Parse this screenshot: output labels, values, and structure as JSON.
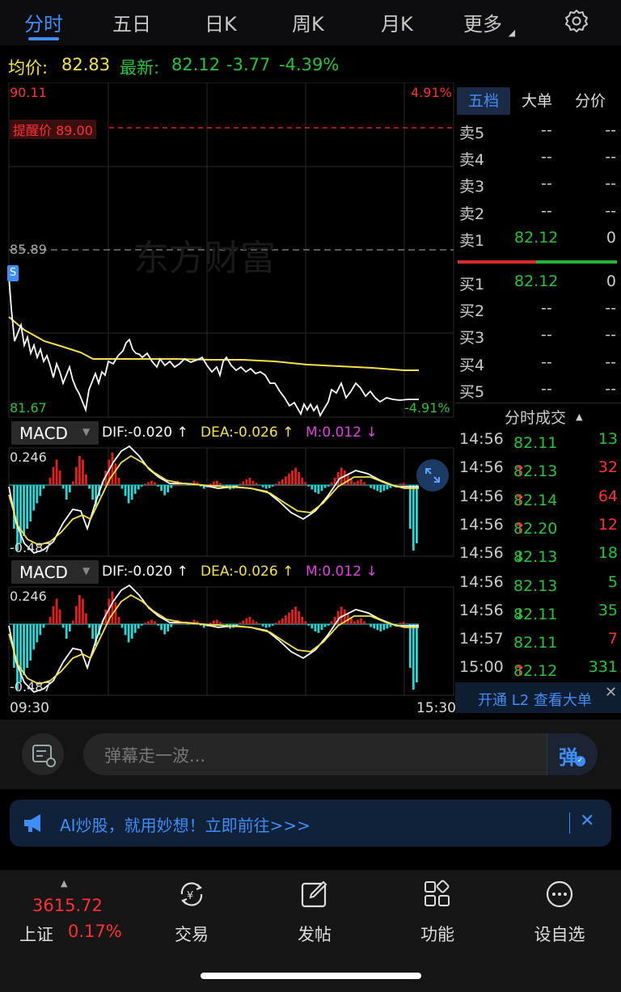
{
  "tabs": [
    {
      "label": "分时",
      "active": true
    },
    {
      "label": "五日"
    },
    {
      "label": "日K"
    },
    {
      "label": "周K"
    },
    {
      "label": "月K"
    },
    {
      "label": "更多"
    }
  ],
  "info": {
    "avg_label": "均价:",
    "avg_value": "82.83",
    "last_label": "最新:",
    "last_value": "82.12",
    "change": "-3.77",
    "change_pct": "-4.39%"
  },
  "price_chart": {
    "y_max": "90.11",
    "y_max_pct": "4.91%",
    "y_mid": "85.89",
    "y_min": "81.67",
    "y_min_pct": "-4.91%",
    "alert_label": "提醒价 89.00",
    "watermark": "东方财富",
    "marker": "S"
  },
  "macd_panels": [
    {
      "name": "MACD",
      "dif": "DIF:-0.020 ↑",
      "dea": "DEA:-0.026 ↑",
      "m": "M:0.012 ↓",
      "y_top": "0.246",
      "y_bottom": "-0.487"
    },
    {
      "name": "MACD",
      "dif": "DIF:-0.020 ↑",
      "dea": "DEA:-0.026 ↑",
      "m": "M:0.012 ↓",
      "y_top": "0.246",
      "y_bottom": "-0.487"
    }
  ],
  "time_axis": {
    "start": "09:30",
    "end": "15:30"
  },
  "right_panel": {
    "tabs": [
      "五档",
      "大单",
      "分价"
    ],
    "asks": [
      {
        "label": "卖5",
        "price": "--",
        "vol": "--"
      },
      {
        "label": "卖4",
        "price": "--",
        "vol": "--"
      },
      {
        "label": "卖3",
        "price": "--",
        "vol": "--"
      },
      {
        "label": "卖2",
        "price": "--",
        "vol": "--"
      },
      {
        "label": "卖1",
        "price": "82.12",
        "vol": "0"
      }
    ],
    "bids": [
      {
        "label": "买1",
        "price": "82.12",
        "vol": "0"
      },
      {
        "label": "买2",
        "price": "--",
        "vol": "--"
      },
      {
        "label": "买3",
        "price": "--",
        "vol": "--"
      },
      {
        "label": "买4",
        "price": "--",
        "vol": "--"
      },
      {
        "label": "买5",
        "price": "--",
        "vol": "--"
      }
    ],
    "trades_header": "分时成交",
    "trades": [
      {
        "time": "14:56",
        "price": "82.11",
        "arrow": "",
        "vol": "13",
        "vol_color": "#27c43a"
      },
      {
        "time": "14:56",
        "price": "82.13",
        "arrow": "↑",
        "vol": "32",
        "vol_color": "#ff3030"
      },
      {
        "time": "14:56",
        "price": "82.14",
        "arrow": "↑",
        "vol": "64",
        "vol_color": "#ff3030"
      },
      {
        "time": "14:56",
        "price": "82.20",
        "arrow": "↑",
        "vol": "12",
        "vol_color": "#ff3030"
      },
      {
        "time": "14:56",
        "price": "82.13",
        "arrow": "↓",
        "vol": "18",
        "vol_color": "#27c43a"
      },
      {
        "time": "14:56",
        "price": "82.13",
        "arrow": "",
        "vol": "5",
        "vol_color": "#27c43a"
      },
      {
        "time": "14:56",
        "price": "82.11",
        "arrow": "↓",
        "vol": "35",
        "vol_color": "#27c43a"
      },
      {
        "time": "14:57",
        "price": "82.11",
        "arrow": "",
        "vol": "7",
        "vol_color": "#ff3030"
      },
      {
        "time": "15:00",
        "price": "82.12",
        "arrow": "↑",
        "vol": "331",
        "vol_color": "#27c43a"
      }
    ],
    "l2_banner": "开通 L2 查看大单"
  },
  "danmu": {
    "placeholder": "弹幕走一波...",
    "button": "弹"
  },
  "ai_banner": {
    "text": "AI炒股，就用妙想！立即前往>>>"
  },
  "bottom_nav": {
    "index_value": "3615.72",
    "index_name": "上证",
    "index_pct": "0.17%",
    "items": [
      "交易",
      "发帖",
      "功能",
      "设自选"
    ]
  },
  "colors": {
    "up": "#ff3030",
    "down": "#27c43a",
    "accent": "#3e8ef7",
    "avg_line": "#f5e14a",
    "macd_pos": "#e0201b",
    "macd_neg": "#2cd4d4"
  }
}
